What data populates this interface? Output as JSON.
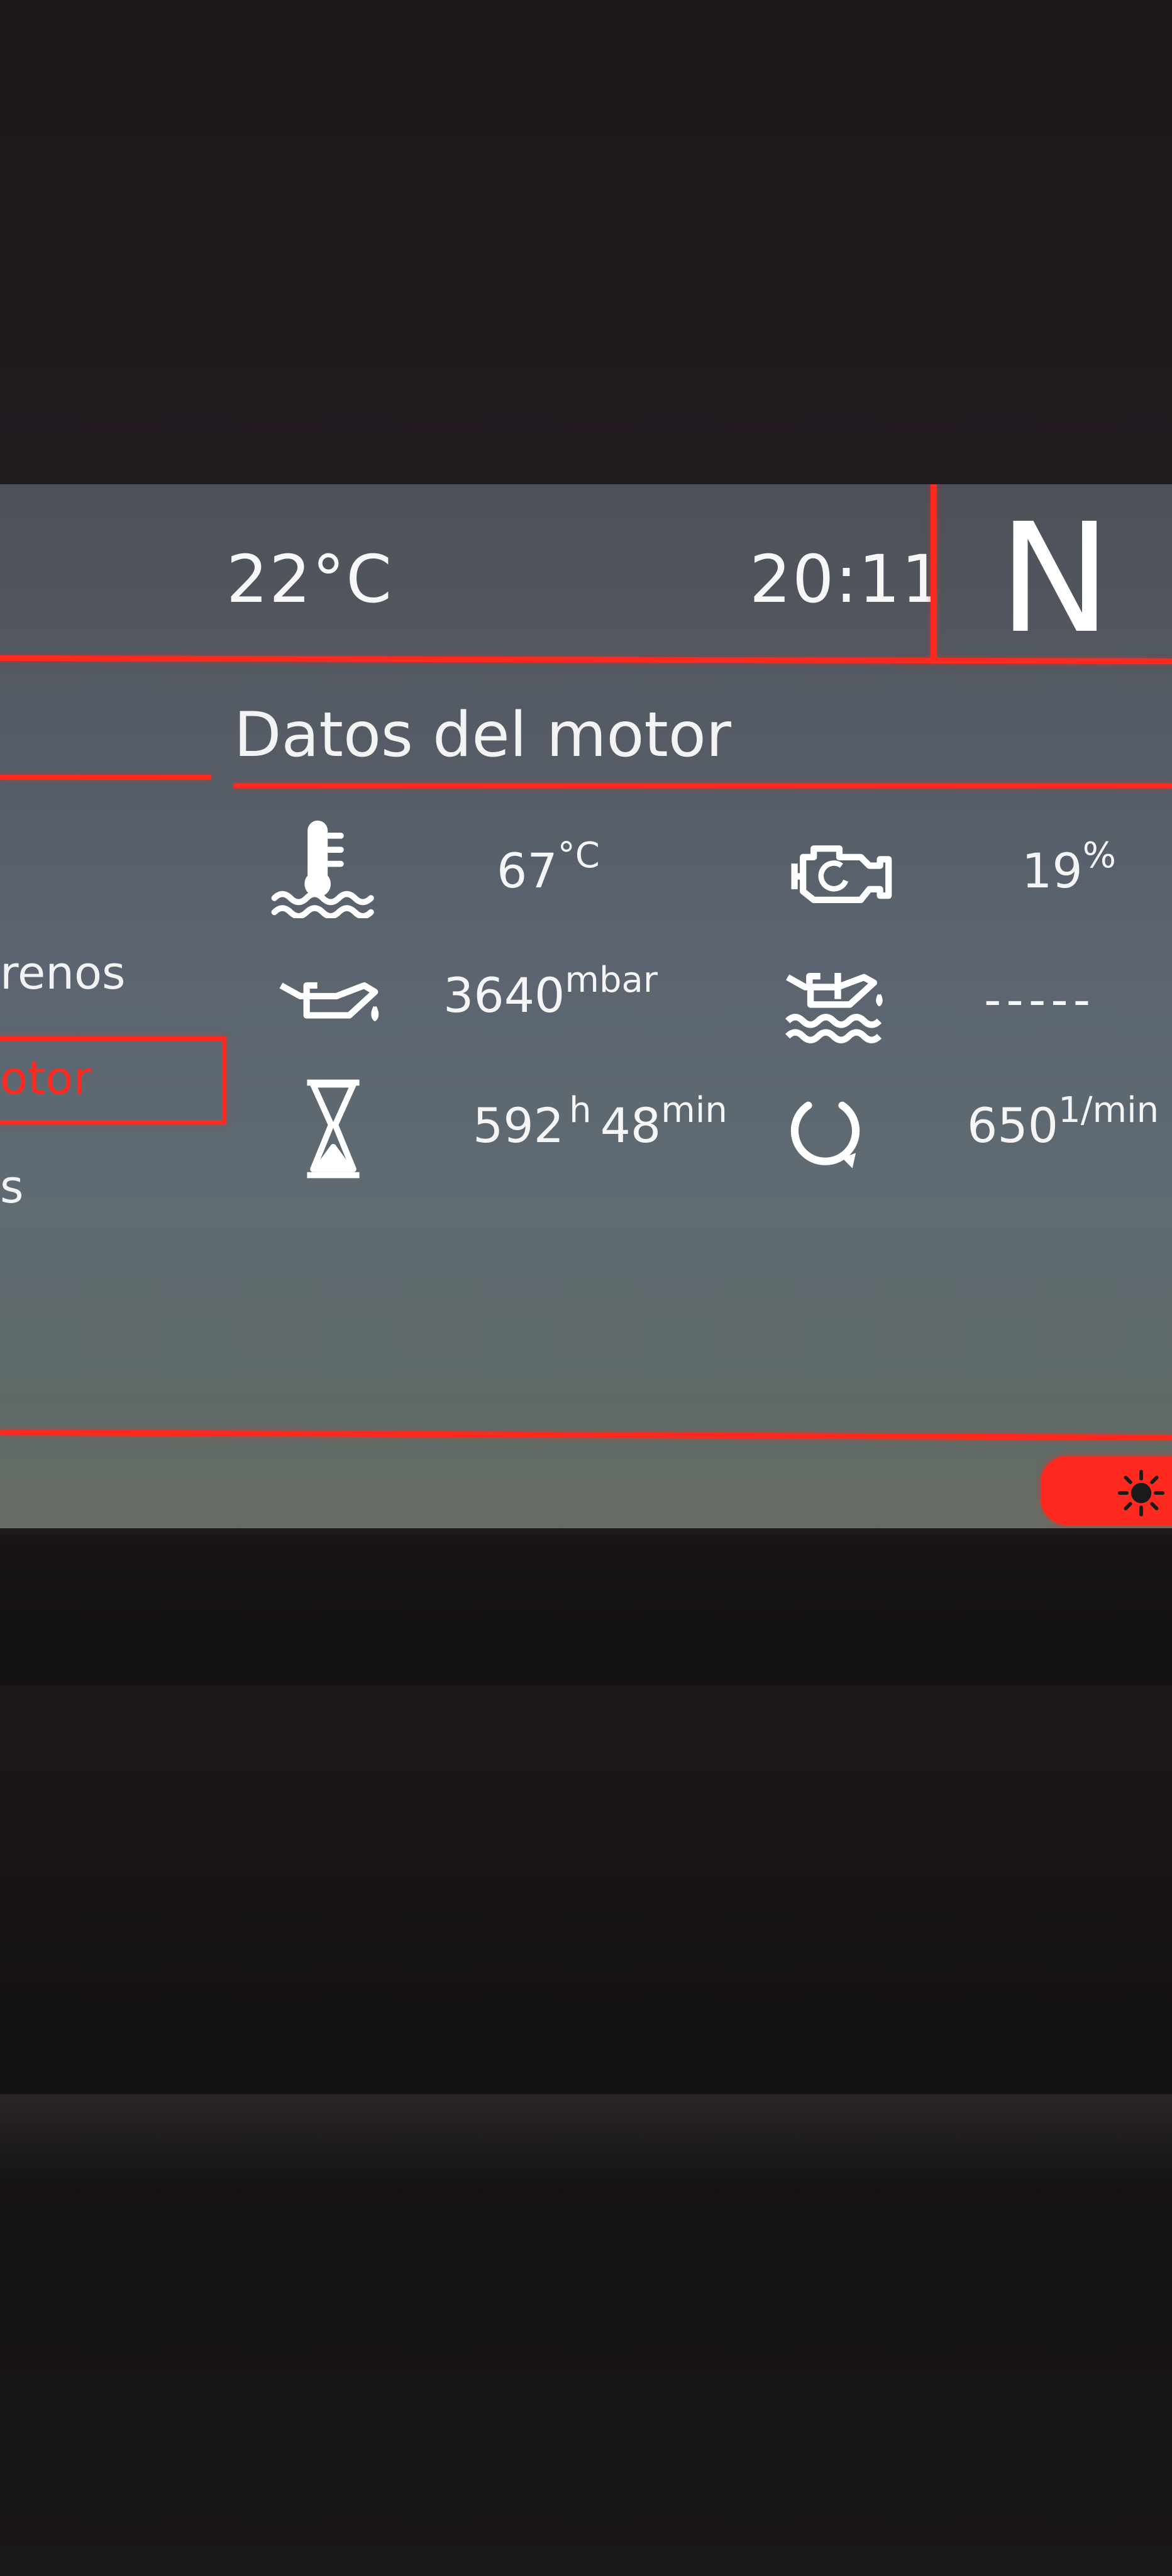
{
  "header": {
    "outside_temp": "22°C",
    "clock": "20:11",
    "gear": "N"
  },
  "page": {
    "title": "Datos del motor"
  },
  "menu": {
    "items": [
      {
        "label": "renos",
        "selected": false
      },
      {
        "label": "otor",
        "selected": true
      },
      {
        "label": "s",
        "selected": false
      }
    ]
  },
  "readings": {
    "coolant_temp": {
      "icon": "coolant-temperature-icon",
      "value": "67",
      "unit": "°C"
    },
    "engine_load": {
      "icon": "engine-icon",
      "value": "19",
      "unit": "%"
    },
    "oil_pressure": {
      "icon": "oil-can-icon",
      "value": "3640",
      "unit": "mbar"
    },
    "oil_temp": {
      "icon": "oil-temperature-icon",
      "value": "-----"
    },
    "operating_time": {
      "icon": "hourglass-icon",
      "hours": "592",
      "hours_unit": "h",
      "minutes": "48",
      "minutes_unit": "min"
    },
    "engine_speed": {
      "icon": "rpm-icon",
      "value": "650",
      "unit": "1/min"
    }
  },
  "controls": {
    "brightness_button": {
      "icon": "sun-icon"
    }
  },
  "colors": {
    "accent": "#ff2a1f",
    "text": "#f5f5f5",
    "screen": "#5b6470"
  }
}
